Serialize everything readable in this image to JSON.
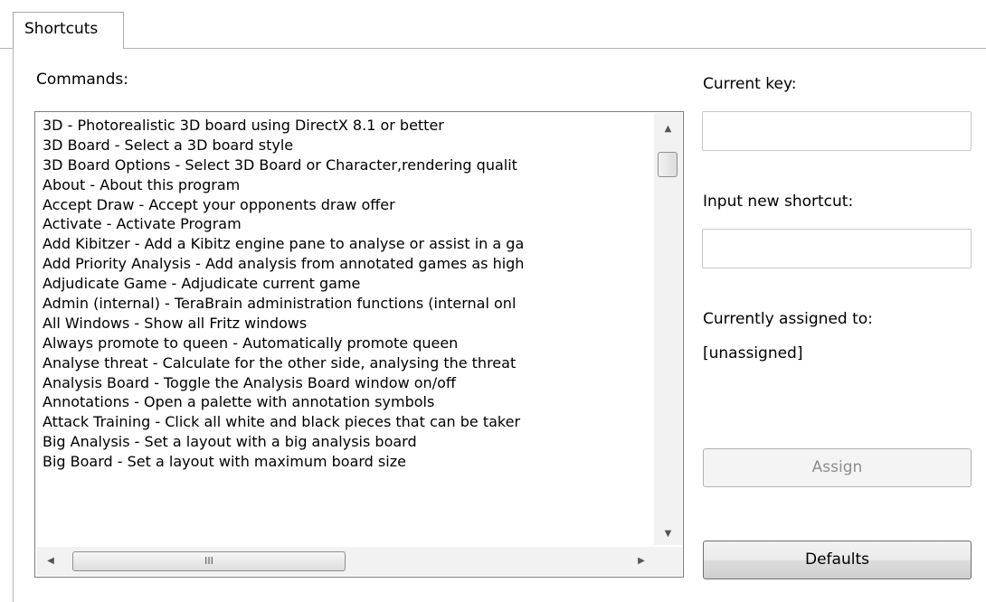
{
  "tab": {
    "label": "Shortcuts"
  },
  "commands": {
    "label": "Commands:",
    "items": [
      "3D - Photorealistic 3D board using DirectX 8.1 or better",
      "3D Board - Select a 3D board style",
      "3D Board Options - Select 3D Board or Character,rendering qualit",
      "About - About this program",
      "Accept Draw - Accept your opponents draw offer",
      "Activate - Activate Program",
      "Add Kibitzer - Add a Kibitz engine pane to analyse or assist in a ga",
      "Add Priority Analysis - Add analysis from annotated games as high",
      "Adjudicate Game - Adjudicate current game",
      "Admin (internal) - TeraBrain administration functions (internal onl",
      "All Windows - Show all Fritz windows",
      "Always promote to queen - Automatically promote queen",
      "Analyse threat - Calculate for the other side, analysing the threat",
      "Analysis Board - Toggle the Analysis Board window on/off",
      "Annotations - Open a palette with annotation symbols",
      "Attack Training - Click all white and black pieces that can be taker",
      "Big Analysis - Set a layout with a big analysis board",
      "Big Board - Set a layout with maximum board size"
    ]
  },
  "current_key": {
    "label": "Current key:",
    "value": ""
  },
  "new_shortcut": {
    "label": "Input new shortcut:",
    "value": ""
  },
  "assigned": {
    "label": "Currently assigned to:",
    "value": "[unassigned]"
  },
  "buttons": {
    "assign": "Assign",
    "defaults": "Defaults"
  },
  "scrollbar": {
    "thumb_grip": "III"
  }
}
